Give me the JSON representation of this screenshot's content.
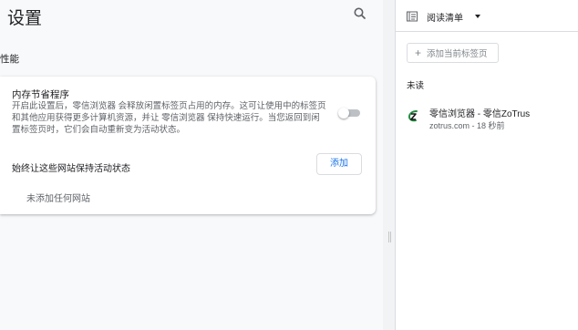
{
  "settings": {
    "title": "设置",
    "search_icon": "search-icon",
    "section": "性能",
    "memory_saver": {
      "title": "内存节省程序",
      "description": "开启此设置后，零信浏览器 会释放闲置标签页占用的内存。这可让使用中的标签页和其他应用获得更多计算机资源，并让 零信浏览器 保持快速运行。当您返回到闲置标签页时，它们会自动重新变为活动状态。",
      "enabled": false
    },
    "keep_active": {
      "label": "始终让这些网站保持活动状态",
      "add_button": "添加",
      "empty_text": "未添加任何网站"
    }
  },
  "side_panel": {
    "selector_label": "阅读清单",
    "selector_icon": "reading-list-icon",
    "add_current_label": "添加当前标签页",
    "unread_header": "未读",
    "items": [
      {
        "title": "零信浏览器 - 零信ZoTrus",
        "domain": "zotrus.com",
        "separator": " - ",
        "time": "18 秒前",
        "favicon": "zotrus-favicon"
      }
    ]
  },
  "colors": {
    "accent": "#1a73e8",
    "toggle_off": "#bdc1c6",
    "muted_text": "#5f6368",
    "brand_green": "#1e8e3e"
  }
}
